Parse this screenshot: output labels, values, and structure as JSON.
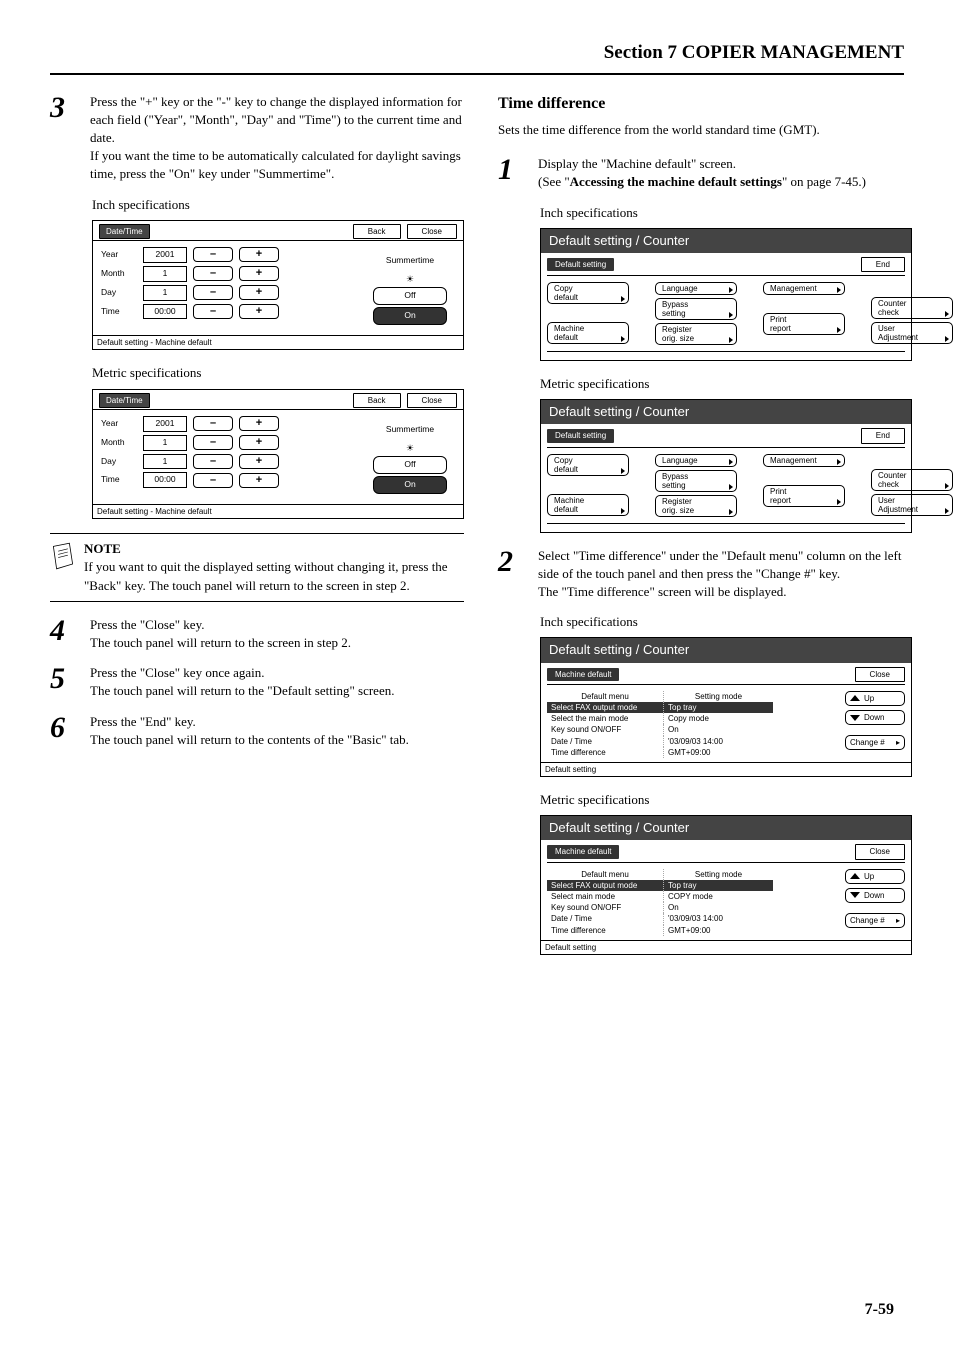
{
  "header": {
    "section_title": "Section 7  COPIER MANAGEMENT"
  },
  "left": {
    "step3": {
      "num": "3",
      "p1": "Press the \"+\" key or the \"-\" key to change the displayed information for each field (\"Year\", \"Month\", \"Day\" and \"Time\") to the current time and date.",
      "p2": "If you want the time to be automatically calculated for daylight savings time, press the \"On\" key under \"Summertime\"."
    },
    "cap_inch": "Inch specifications",
    "cap_metric": "Metric specifications",
    "dt_panel": {
      "title": "Date/Time",
      "back": "Back",
      "close": "Close",
      "rows": [
        {
          "label": "Year",
          "value": "2001"
        },
        {
          "label": "Month",
          "value": "1"
        },
        {
          "label": "Day",
          "value": "1"
        },
        {
          "label": "Time",
          "value": "00:00"
        }
      ],
      "summertime": "Summertime",
      "off": "Off",
      "on": "On",
      "footer": "Default setting - Machine default"
    },
    "note": {
      "title": "NOTE",
      "body": "If you want to quit the displayed setting without changing it, press the \"Back\" key. The touch panel will return to the screen in step 2."
    },
    "step4": {
      "num": "4",
      "p1": "Press the \"Close\" key.",
      "p2": "The touch panel will return to the screen in step 2."
    },
    "step5": {
      "num": "5",
      "p1": "Press the \"Close\" key once again.",
      "p2": "The touch panel will return to the \"Default setting\" screen."
    },
    "step6": {
      "num": "6",
      "p1": "Press the \"End\" key.",
      "p2": "The touch panel will return to the contents of the \"Basic\" tab."
    }
  },
  "right": {
    "title": "Time difference",
    "intro": "Sets the time difference from the world standard time (GMT).",
    "step1": {
      "num": "1",
      "p1": "Display the \"Machine default\" screen.",
      "p2a": "(See \"",
      "p2b": "Accessing the machine default settings",
      "p2c": "\" on page 7-45.)"
    },
    "cap_inch": "Inch specifications",
    "cap_metric": "Metric specifications",
    "ds_panel": {
      "title": "Default setting / Counter",
      "tag": "Default setting",
      "end": "End",
      "col1": [
        "Copy\ndefault",
        "Machine\ndefault"
      ],
      "col2": [
        "Language",
        "Bypass\nsetting",
        "Register\norig. size"
      ],
      "col3": [
        "Management",
        "Print\nreport"
      ],
      "col4": [
        "Counter\ncheck",
        "User\nAdjustment"
      ]
    },
    "step2": {
      "num": "2",
      "p1": "Select \"Time difference\" under the \"Default menu\" column on the left side of the touch panel and then press the \"Change #\" key.",
      "p2": "The \"Time difference\" screen will be displayed."
    },
    "mn_panel_inch": {
      "title": "Default setting / Counter",
      "tag": "Machine default",
      "close": "Close",
      "head1": "Default menu",
      "head2": "Setting mode",
      "rows": [
        {
          "c1": "Select FAX output mode",
          "c2": "Top tray",
          "sel": true
        },
        {
          "c1": "Select the main mode",
          "c2": "Copy mode"
        },
        {
          "c1": "Key sound ON/OFF",
          "c2": "On"
        },
        {
          "c1": "Date / Time",
          "c2": "'03/09/03 14:00"
        },
        {
          "c1": "Time difference",
          "c2": "GMT+09:00"
        }
      ],
      "up": "Up",
      "down": "Down",
      "change": "Change #",
      "footer": "Default setting"
    },
    "mn_panel_metric": {
      "title": "Default setting / Counter",
      "tag": "Machine default",
      "close": "Close",
      "head1": "Default menu",
      "head2": "Setting mode",
      "rows": [
        {
          "c1": "Select FAX output mode",
          "c2": "Top tray",
          "sel": true
        },
        {
          "c1": "Select main mode",
          "c2": "COPY mode"
        },
        {
          "c1": "Key sound ON/OFF",
          "c2": "On"
        },
        {
          "c1": "Date / Time",
          "c2": "'03/09/03 14:00"
        },
        {
          "c1": "Time difference",
          "c2": "GMT+09:00"
        }
      ],
      "up": "Up",
      "down": "Down",
      "change": "Change #",
      "footer": "Default setting"
    }
  },
  "page_num": "7-59"
}
